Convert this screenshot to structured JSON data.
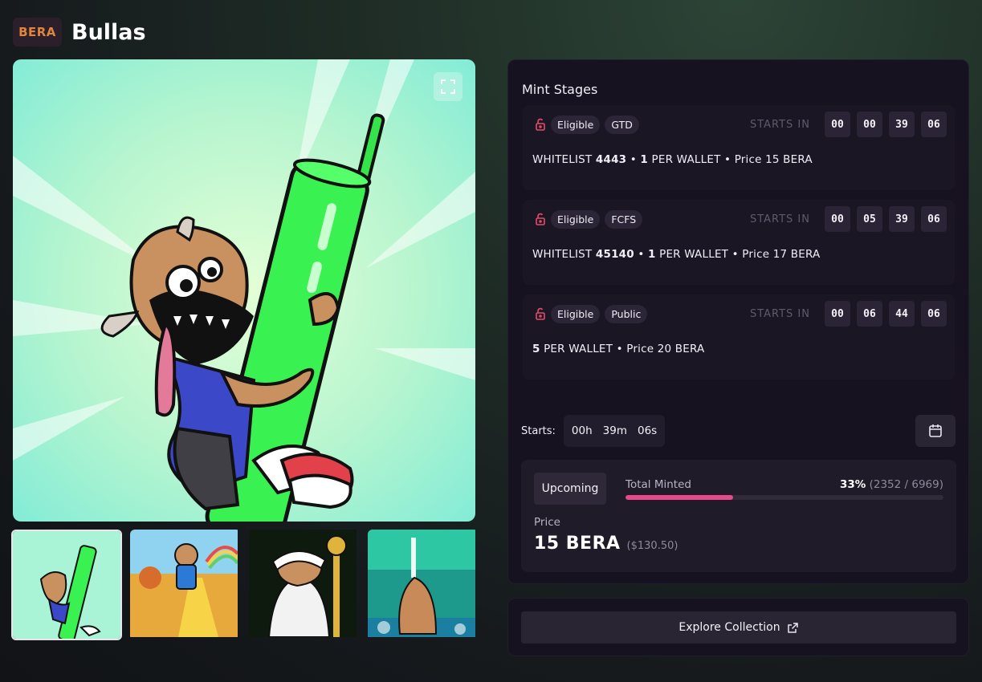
{
  "header": {
    "chain_badge": "BERA",
    "title": "Bullas"
  },
  "gallery": {
    "main_image": "bull-climbing-green-candle",
    "thumbnails": [
      "bull-green-candle",
      "bull-on-gold-road",
      "bull-in-white-hoodie",
      "bull-with-sword-waterfall"
    ],
    "expand_icon": "expand-icon"
  },
  "mint_stages": {
    "title": "Mint Stages",
    "stages": [
      {
        "status": "Eligible",
        "type": "GTD",
        "starts_in_label": "STARTS IN",
        "countdown": [
          "00",
          "00",
          "39",
          "06"
        ],
        "list": "WHITELIST",
        "count": "4443",
        "per_wallet": "1",
        "per_wallet_label": "PER WALLET",
        "price": "Price 15 BERA"
      },
      {
        "status": "Eligible",
        "type": "FCFS",
        "starts_in_label": "STARTS IN",
        "countdown": [
          "00",
          "05",
          "39",
          "06"
        ],
        "list": "WHITELIST",
        "count": "45140",
        "per_wallet": "1",
        "per_wallet_label": "PER WALLET",
        "price": "Price 17 BERA"
      },
      {
        "status": "Eligible",
        "type": "Public",
        "starts_in_label": "STARTS IN",
        "countdown": [
          "00",
          "06",
          "44",
          "06"
        ],
        "per_wallet": "5",
        "per_wallet_label": "PER WALLET",
        "price": "Price 20 BERA"
      }
    ],
    "starts_label": "Starts:",
    "starts_timer": {
      "hours": "00h",
      "minutes": "39m",
      "seconds": "06s"
    },
    "calendar_icon": "calendar-icon"
  },
  "mint_box": {
    "status": "Upcoming",
    "total_minted_label": "Total Minted",
    "percent": "33%",
    "counts": "(2352 / 6969)",
    "progress_fraction": 0.3375,
    "price_label": "Price",
    "price": "15 BERA",
    "price_usd": "($130.50)"
  },
  "explore": {
    "label": "Explore Collection",
    "icon": "external-link-icon"
  },
  "colors": {
    "accent": "#e64a8c",
    "bera_orange": "#e0863a",
    "panel": "#16121f"
  }
}
